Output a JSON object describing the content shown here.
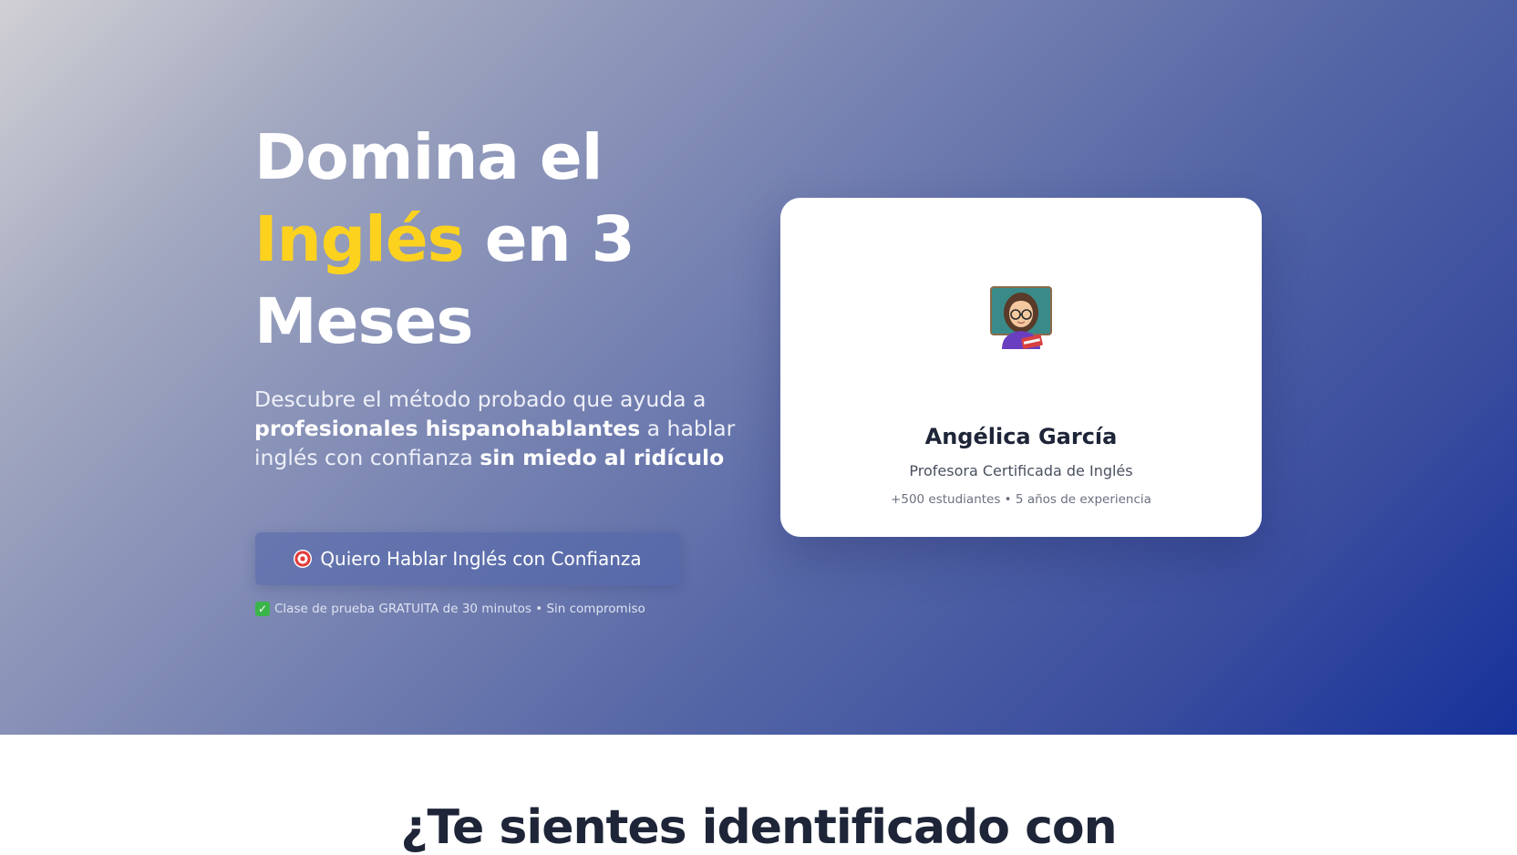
{
  "hero": {
    "headline_line1": "Domina el",
    "headline_accent": "Inglés",
    "headline_line2_rest": " en 3",
    "headline_line3": "Meses",
    "subhead_part1": "Descubre el método probado que ayuda a ",
    "subhead_bold1": "profesionales hispanohablantes",
    "subhead_part2": " a hablar inglés con confianza ",
    "subhead_bold2": "sin miedo al ridículo",
    "cta_label": "Quiero Hablar Inglés con Confianza",
    "cta_icon": "target-icon",
    "note": "Clase de prueba GRATUITA de 30 minutos • Sin compromiso",
    "note_icon": "check-icon"
  },
  "profile_card": {
    "avatar_icon": "teacher-emoji",
    "name": "Angélica García",
    "role": "Profesora Certificada de Inglés",
    "stats": "+500 estudiantes • 5 años de experiencia"
  },
  "section2": {
    "title": "¿Te sientes identificado con"
  },
  "colors": {
    "accent": "#fcd21f",
    "gradient_start": "#d0d0d4",
    "gradient_end": "#16319a",
    "text_dark": "#1e2538"
  }
}
